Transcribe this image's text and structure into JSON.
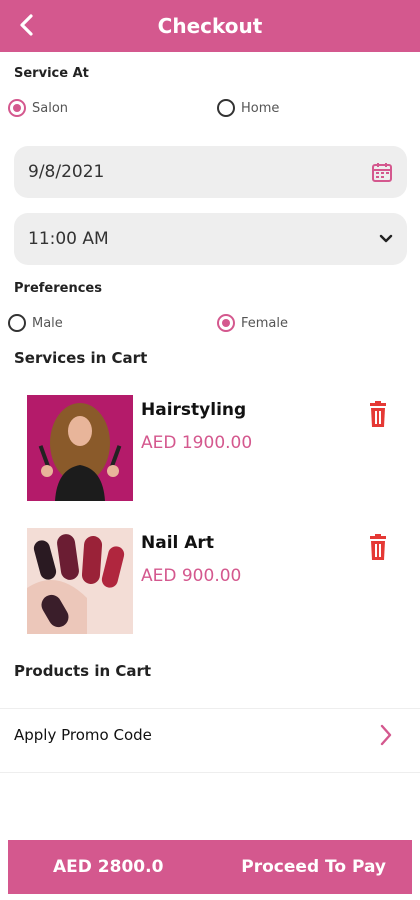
{
  "header": {
    "title": "Checkout"
  },
  "service_at": {
    "label": "Service At",
    "options": [
      {
        "label": "Salon",
        "checked": true
      },
      {
        "label": "Home",
        "checked": false
      }
    ]
  },
  "date_field": {
    "value": "9/8/2021",
    "icon": "calendar-icon"
  },
  "time_field": {
    "value": "11:00 AM",
    "icon": "chevron-down-icon"
  },
  "preferences": {
    "label": "Preferences",
    "options": [
      {
        "label": "Male",
        "checked": false
      },
      {
        "label": "Female",
        "checked": true
      }
    ]
  },
  "services_cart": {
    "title": "Services in Cart",
    "items": [
      {
        "name": "Hairstyling",
        "price": "AED 1900.00"
      },
      {
        "name": "Nail Art",
        "price": "AED 900.00"
      }
    ]
  },
  "products_cart": {
    "title": "Products in Cart"
  },
  "promo": {
    "label": "Apply Promo Code"
  },
  "pay_bar": {
    "total": "AED 2800.0",
    "action": "Proceed To Pay"
  },
  "colors": {
    "brand": "#d4588e",
    "delete": "#e53935",
    "field_bg": "#eeeeee"
  }
}
